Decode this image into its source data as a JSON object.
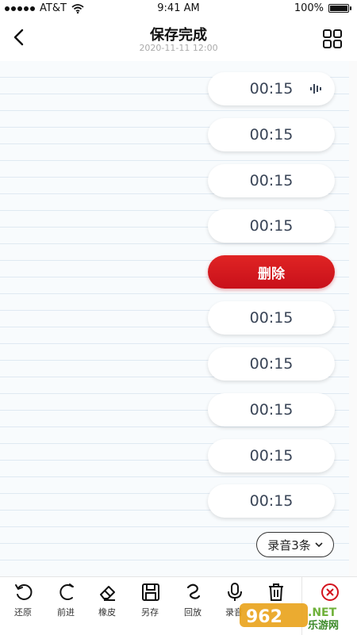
{
  "status_bar": {
    "carrier": "AT&T",
    "time": "9:41 AM",
    "battery": "100%"
  },
  "header": {
    "title": "保存完成",
    "subtitle": "2020-11-11 12:00"
  },
  "recordings": [
    {
      "label": "00:15"
    },
    {
      "label": "00:15"
    },
    {
      "label": "00:15"
    },
    {
      "label": "00:15"
    },
    {
      "label": "删除"
    },
    {
      "label": "00:15"
    },
    {
      "label": "00:15"
    },
    {
      "label": "00:15"
    },
    {
      "label": "00:15"
    },
    {
      "label": "00:15"
    }
  ],
  "recording_count_label": "录音3条",
  "toolbar": {
    "restore": "还原",
    "forward": "前进",
    "eraser": "橡皮",
    "save_as": "另存",
    "playback": "回放",
    "record": "录音"
  },
  "watermark": {
    "brand": "962",
    "domain": ".NET",
    "site_name": "乐游网"
  },
  "colors": {
    "accent_red": "#d4141e",
    "text_dark": "#3a4557"
  }
}
